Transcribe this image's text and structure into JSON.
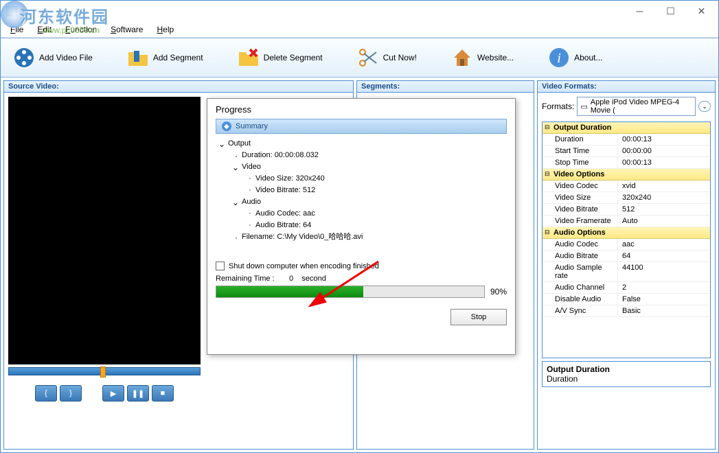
{
  "watermark": {
    "text1": "河东软件园",
    "text2": "www.pc0359.cn"
  },
  "menu": {
    "file": "File",
    "edit": "Edit",
    "function": "Function",
    "software": "Software",
    "help": "Help"
  },
  "toolbar": {
    "addVideo": "Add Video File",
    "addSegment": "Add Segment",
    "deleteSegment": "Delete Segment",
    "cutNow": "Cut Now!",
    "website": "Website...",
    "about": "About..."
  },
  "panels": {
    "source": "Source Video:",
    "segments": "Segments:",
    "formats": "Video Formats:"
  },
  "formats": {
    "label": "Formats:",
    "selected": "Apple iPod Video MPEG-4 Movie ("
  },
  "props": {
    "outputDuration": {
      "header": "Output Duration",
      "duration_k": "Duration",
      "duration_v": "00:00:13",
      "start_k": "Start Time",
      "start_v": "00:00:00",
      "stop_k": "Stop Time",
      "stop_v": "00:00:13"
    },
    "videoOptions": {
      "header": "Video Options",
      "codec_k": "Video Codec",
      "codec_v": "xvid",
      "size_k": "Video Size",
      "size_v": "320x240",
      "bitrate_k": "Video Bitrate",
      "bitrate_v": "512",
      "framerate_k": "Video Framerate",
      "framerate_v": "Auto"
    },
    "audioOptions": {
      "header": "Audio Options",
      "codec_k": "Audio Codec",
      "codec_v": "aac",
      "bitrate_k": "Audio Bitrate",
      "bitrate_v": "64",
      "sample_k": "Audio Sample rate",
      "sample_v": "44100",
      "channel_k": "Audio Channel",
      "channel_v": "2",
      "disable_k": "Disable Audio",
      "disable_v": "False",
      "sync_k": "A/V Sync",
      "sync_v": "Basic"
    }
  },
  "outputDurBox": {
    "header": "Output Duration",
    "line": "Duration"
  },
  "progress": {
    "title": "Progress",
    "summary": "Summary",
    "tree": {
      "output": "Output",
      "duration": "Duration: 00:00:08.032",
      "video": "Video",
      "videoSize": "Video Size: 320x240",
      "videoBitrate": "Video Bitrate: 512",
      "audio": "Audio",
      "audioCodec": "Audio Codec: aac",
      "audioBitrate": "Audio Bitrate: 64",
      "filename": "Filename: C:\\My Video\\0_哈哈哈.avi"
    },
    "shutdown": "Shut down computer when encoding finished",
    "remainingLabel": "Remaining Time :",
    "remainingValue": "0",
    "remainingUnit": "second",
    "percent": "90%",
    "stop": "Stop"
  }
}
